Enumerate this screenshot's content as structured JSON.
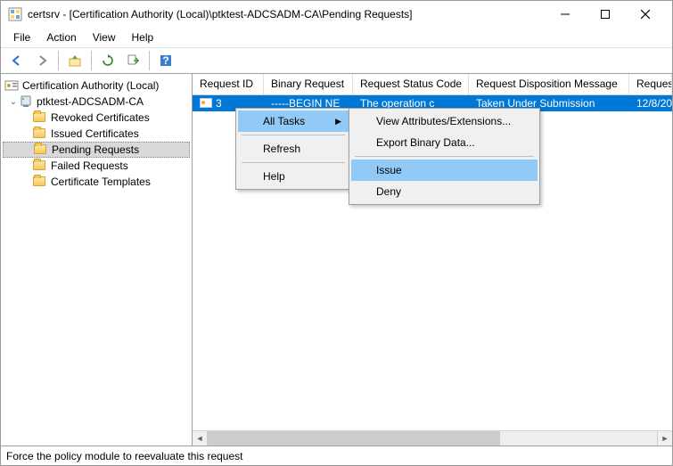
{
  "titlebar": {
    "title": "certsrv - [Certification Authority (Local)\\ptktest-ADCSADM-CA\\Pending Requests]"
  },
  "menubar": {
    "file": "File",
    "action": "Action",
    "view": "View",
    "help": "Help"
  },
  "tree": {
    "root": "Certification Authority (Local)",
    "ca": "ptktest-ADCSADM-CA",
    "revoked": "Revoked Certificates",
    "issued": "Issued Certificates",
    "pending": "Pending Requests",
    "failed": "Failed Requests",
    "templates": "Certificate Templates"
  },
  "columns": {
    "request_id": "Request ID",
    "binary_request": "Binary Request",
    "status_code": "Request Status Code",
    "disposition": "Request Disposition Message",
    "requester": "Request"
  },
  "row": {
    "id": "3",
    "binary": "-----BEGIN NE",
    "status": "The operation c",
    "disposition": "Taken Under Submission",
    "date": "12/8/20"
  },
  "context_menu": {
    "all_tasks": "All Tasks",
    "refresh": "Refresh",
    "help": "Help",
    "view_attrs": "View Attributes/Extensions...",
    "export_binary": "Export Binary Data...",
    "issue": "Issue",
    "deny": "Deny"
  },
  "statusbar": {
    "text": "Force the policy module to reevaluate this request"
  }
}
